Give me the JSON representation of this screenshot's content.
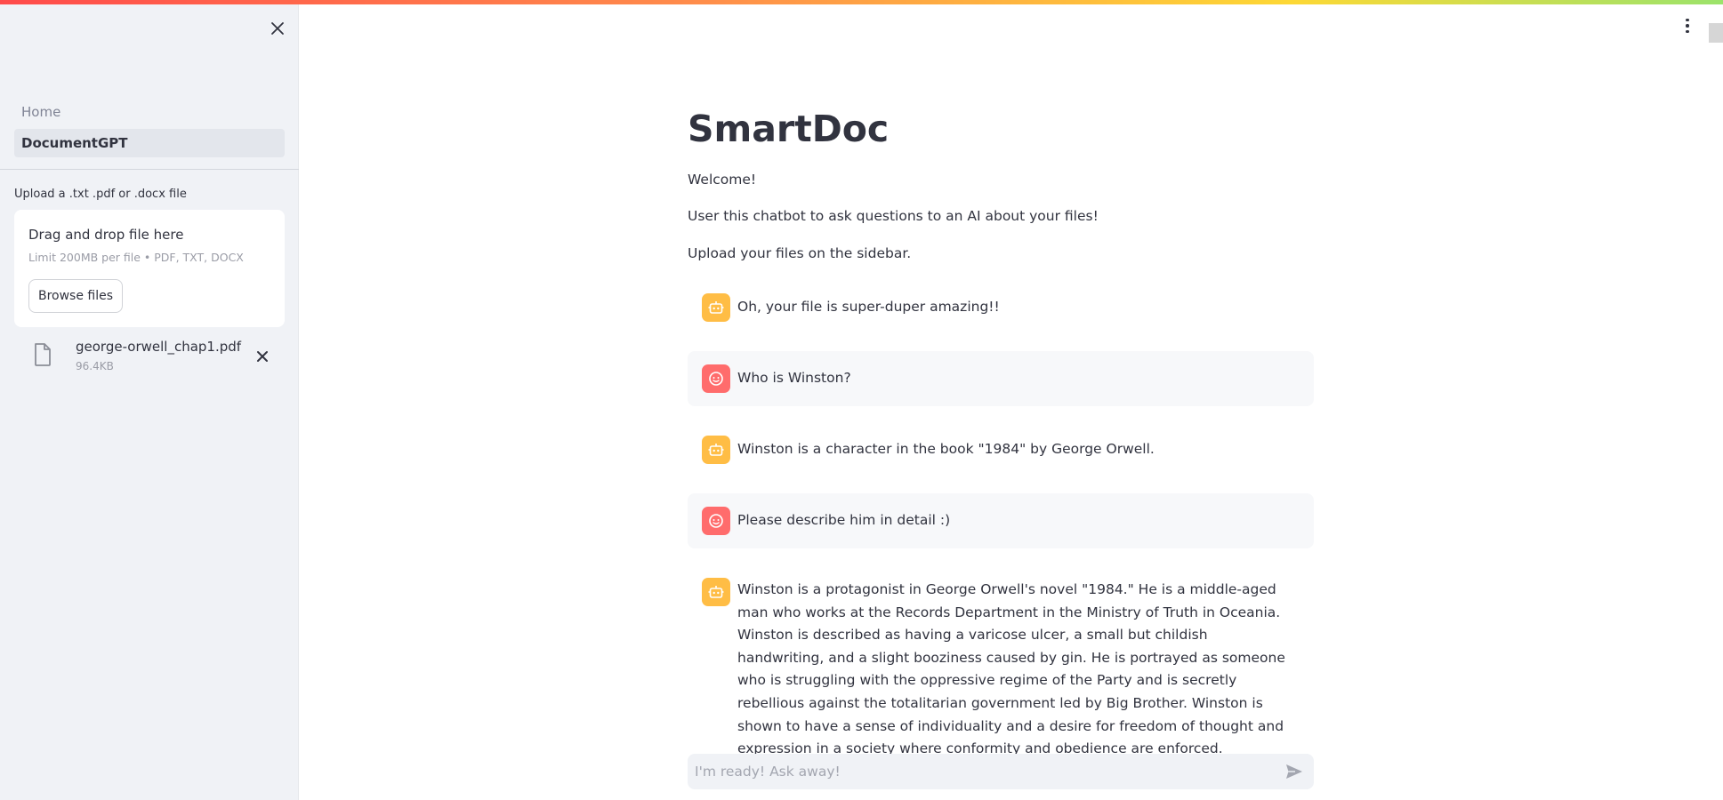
{
  "sidebar": {
    "nav": [
      {
        "label": "Home",
        "active": false
      },
      {
        "label": "DocumentGPT",
        "active": true
      }
    ],
    "uploader": {
      "label": "Upload a .txt .pdf or .docx file",
      "drop_title": "Drag and drop file here",
      "limit": "Limit 200MB per file • PDF, TXT, DOCX",
      "browse_label": "Browse files"
    },
    "file": {
      "name": "george-orwell_chap1.pdf",
      "size": "96.4KB"
    }
  },
  "main": {
    "title": "SmartDoc",
    "intro": [
      "Welcome!",
      "User this chatbot to ask questions to an AI about your files!",
      "Upload your files on the sidebar."
    ],
    "messages": [
      {
        "role": "ai",
        "text": "Oh, your file is super-duper amazing!!"
      },
      {
        "role": "human",
        "text": "Who is Winston?"
      },
      {
        "role": "ai",
        "text": "Winston is a character in the book \"1984\" by George Orwell."
      },
      {
        "role": "human",
        "text": "Please describe him in detail :)"
      },
      {
        "role": "ai",
        "text": "Winston is a protagonist in George Orwell's novel \"1984.\" He is a middle-aged man who works at the Records Department in the Ministry of Truth in Oceania. Winston is described as having a varicose ulcer, a small but childish handwriting, and a slight booziness caused by gin. He is portrayed as someone who is struggling with the oppressive regime of the Party and is secretly rebellious against the totalitarian government led by Big Brother. Winston is shown to have a sense of individuality and a desire for freedom of thought and expression in a society where conformity and obedience are enforced."
      }
    ],
    "chat_input": {
      "placeholder": "I'm ready! Ask away!",
      "value": ""
    }
  },
  "colors": {
    "sidebar_bg": "#f0f2f6",
    "ai_avatar": "#ffbd45",
    "human_avatar": "#ff6c6c",
    "user_message_bg": "#f7f8fa"
  },
  "icons": {
    "sidebar_close": "close-icon",
    "file": "file-icon",
    "file_remove": "close-icon",
    "main_menu": "kebab-menu-icon",
    "ai_avatar": "robot-icon",
    "human_avatar": "smiley-icon",
    "send": "send-icon"
  }
}
